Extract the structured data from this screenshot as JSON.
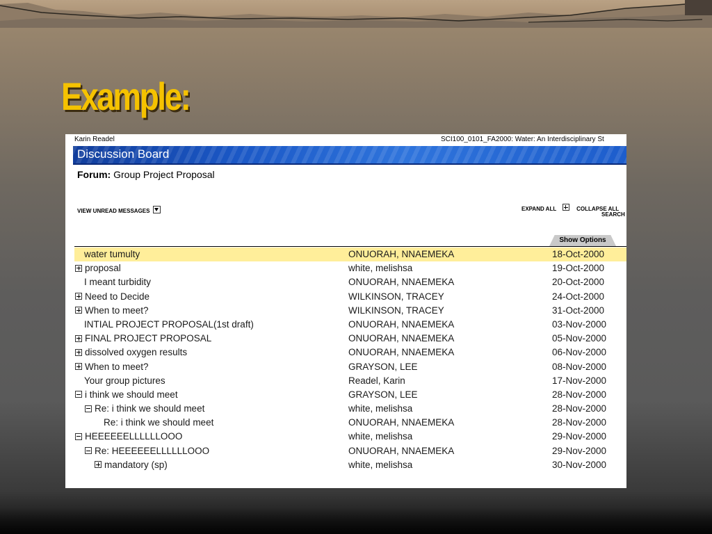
{
  "slide": {
    "title": "Example:"
  },
  "header": {
    "user": "Karin Readel",
    "course": "SCI100_0101_FA2000: Water: An Interdisciplinary St"
  },
  "board": {
    "title": "Discussion Board",
    "forum_label": "Forum:",
    "forum_name": "Group Project Proposal"
  },
  "controls": {
    "view_unread": "VIEW UNREAD MESSAGES",
    "expand_all": "EXPAND ALL",
    "collapse_all": "COLLAPSE ALL",
    "search": "SEARCH",
    "show_options": "Show Options"
  },
  "threads": [
    {
      "subject": "water tumulty",
      "author": "ONUORAH, NNAEMEKA",
      "date": "18-Oct-2000",
      "toggle": "none",
      "indent": 0,
      "highlighted": true
    },
    {
      "subject": "proposal",
      "author": "white, melishsa",
      "date": "19-Oct-2000",
      "toggle": "plus",
      "indent": 0
    },
    {
      "subject": "I meant turbidity",
      "author": "ONUORAH, NNAEMEKA",
      "date": "20-Oct-2000",
      "toggle": "none",
      "indent": 0
    },
    {
      "subject": "Need to Decide",
      "author": "WILKINSON, TRACEY",
      "date": "24-Oct-2000",
      "toggle": "plus",
      "indent": 0
    },
    {
      "subject": "When to meet?",
      "author": "WILKINSON, TRACEY",
      "date": "31-Oct-2000",
      "toggle": "plus",
      "indent": 0
    },
    {
      "subject": "INTIAL PROJECT PROPOSAL(1st draft)",
      "author": "ONUORAH, NNAEMEKA",
      "date": "03-Nov-2000",
      "toggle": "none",
      "indent": 0
    },
    {
      "subject": "FINAL PROJECT PROPOSAL",
      "author": "ONUORAH, NNAEMEKA",
      "date": "05-Nov-2000",
      "toggle": "plus",
      "indent": 0
    },
    {
      "subject": "dissolved oxygen results",
      "author": "ONUORAH, NNAEMEKA",
      "date": "06-Nov-2000",
      "toggle": "plus",
      "indent": 0
    },
    {
      "subject": "When to meet?",
      "author": "GRAYSON, LEE",
      "date": "08-Nov-2000",
      "toggle": "plus",
      "indent": 0
    },
    {
      "subject": "Your group pictures",
      "author": "Readel, Karin",
      "date": "17-Nov-2000",
      "toggle": "none",
      "indent": 0
    },
    {
      "subject": "i think we should meet",
      "author": "GRAYSON, LEE",
      "date": "28-Nov-2000",
      "toggle": "minus",
      "indent": 0
    },
    {
      "subject": "Re: i think we should meet",
      "author": "white, melishsa",
      "date": "28-Nov-2000",
      "toggle": "minus",
      "indent": 1
    },
    {
      "subject": "Re: i think we should meet",
      "author": "ONUORAH, NNAEMEKA",
      "date": "28-Nov-2000",
      "toggle": "none",
      "indent": 2
    },
    {
      "subject": "HEEEEEELLLLLLOOO",
      "author": "white, melishsa",
      "date": "29-Nov-2000",
      "toggle": "minus",
      "indent": 0
    },
    {
      "subject": "Re: HEEEEEELLLLLLOOO",
      "author": "ONUORAH, NNAEMEKA",
      "date": "29-Nov-2000",
      "toggle": "minus",
      "indent": 1
    },
    {
      "subject": "mandatory (sp)",
      "author": "white, melishsa",
      "date": "30-Nov-2000",
      "toggle": "plus",
      "indent": 2
    }
  ]
}
